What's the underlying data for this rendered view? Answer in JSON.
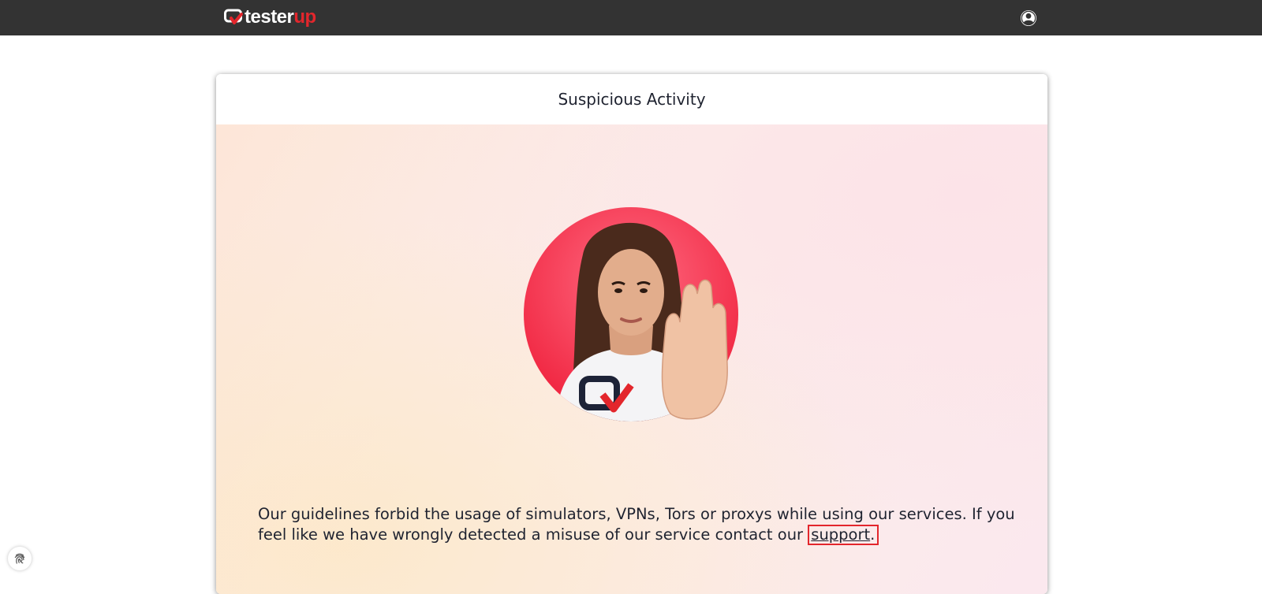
{
  "header": {
    "logo": {
      "text_main": "tester",
      "text_accent": "up"
    },
    "user_icon": "user-circle-icon"
  },
  "card": {
    "title": "Suspicious Activity",
    "image": "woman-stop-gesture-avatar",
    "message_text": "Our guidelines forbid the usage of simulators, VPNs, Tors or proxys while using our services. If you feel like we have wrongly detected a misuse of our service contact our ",
    "support_link": "support",
    "message_end": "."
  },
  "floating": {
    "icon": "fingerprint-icon"
  },
  "colors": {
    "topbar": "#333333",
    "brand_red": "#e3262c",
    "text": "#1f2330"
  }
}
